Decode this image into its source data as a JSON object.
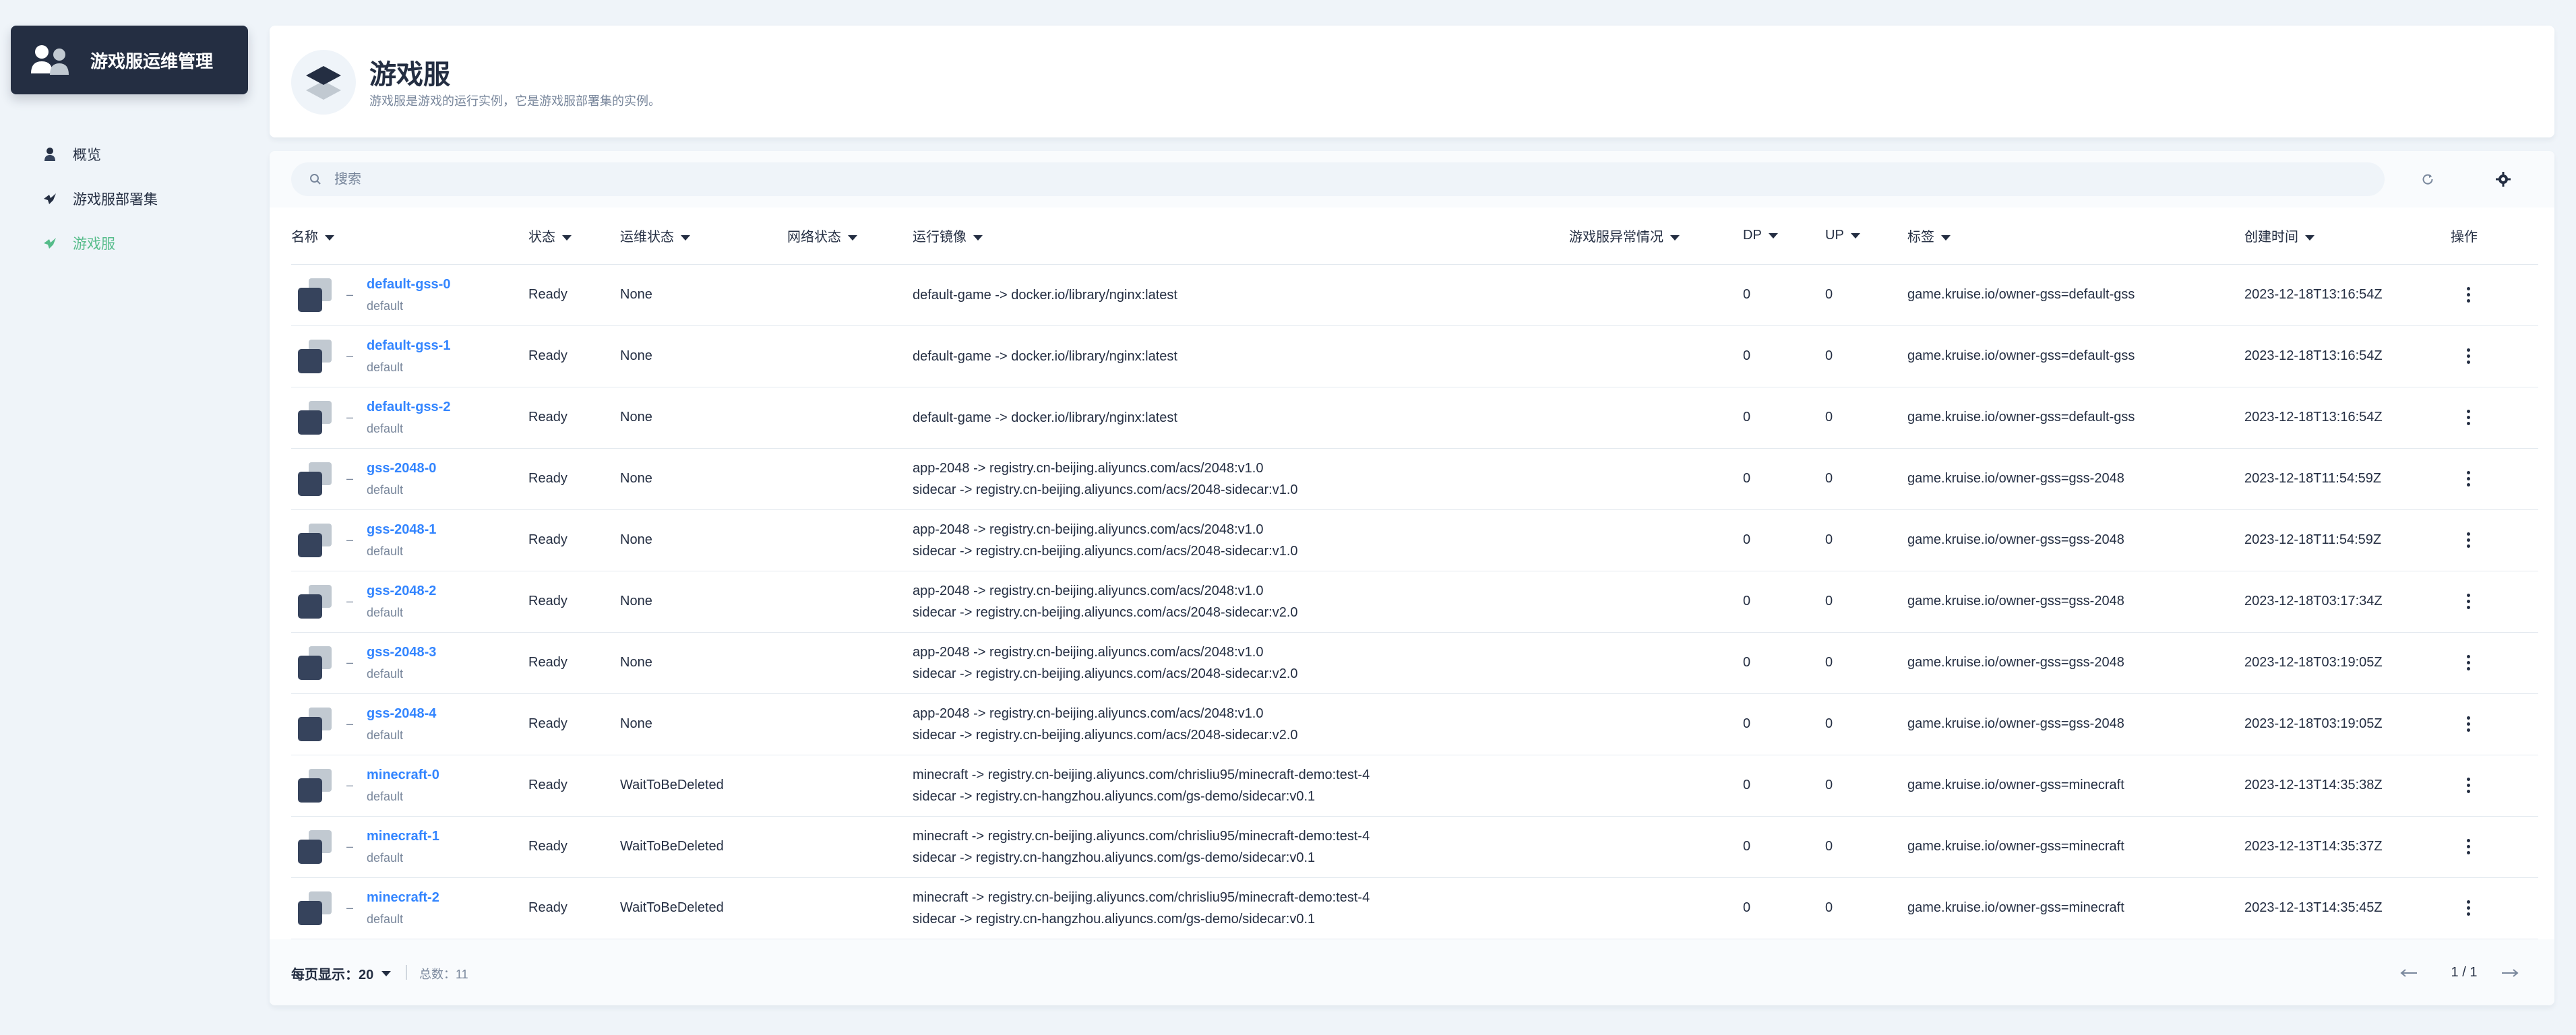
{
  "sidebar": {
    "brand": "游戏服运维管理",
    "items": [
      {
        "label": "概览",
        "icon": "user-icon",
        "active": false
      },
      {
        "label": "游戏服部署集",
        "icon": "bird-icon",
        "active": false
      },
      {
        "label": "游戏服",
        "icon": "bird-icon",
        "active": true
      }
    ]
  },
  "header": {
    "title": "游戏服",
    "description": "游戏服是游戏的运行实例，它是游戏服部署集的实例。"
  },
  "search": {
    "placeholder": "搜索"
  },
  "table": {
    "columns": [
      "名称",
      "状态",
      "运维状态",
      "网络状态",
      "运行镜像",
      "游戏服异常情况",
      "DP",
      "UP",
      "标签",
      "创建时间",
      "操作"
    ],
    "rows": [
      {
        "name": "default-gss-0",
        "namespace": "default",
        "dash": "–",
        "status": "Ready",
        "ops_state": "None",
        "image1": "default-game -> docker.io/library/nginx:latest",
        "image2": "",
        "dp": "0",
        "up": "0",
        "label": "game.kruise.io/owner-gss=default-gss",
        "created": "2023-12-18T13:16:54Z"
      },
      {
        "name": "default-gss-1",
        "namespace": "default",
        "dash": "–",
        "status": "Ready",
        "ops_state": "None",
        "image1": "default-game -> docker.io/library/nginx:latest",
        "image2": "",
        "dp": "0",
        "up": "0",
        "label": "game.kruise.io/owner-gss=default-gss",
        "created": "2023-12-18T13:16:54Z"
      },
      {
        "name": "default-gss-2",
        "namespace": "default",
        "dash": "–",
        "status": "Ready",
        "ops_state": "None",
        "image1": "default-game -> docker.io/library/nginx:latest",
        "image2": "",
        "dp": "0",
        "up": "0",
        "label": "game.kruise.io/owner-gss=default-gss",
        "created": "2023-12-18T13:16:54Z"
      },
      {
        "name": "gss-2048-0",
        "namespace": "default",
        "dash": "–",
        "status": "Ready",
        "ops_state": "None",
        "image1": "app-2048 -> registry.cn-beijing.aliyuncs.com/acs/2048:v1.0",
        "image2": "sidecar -> registry.cn-beijing.aliyuncs.com/acs/2048-sidecar:v1.0",
        "dp": "0",
        "up": "0",
        "label": "game.kruise.io/owner-gss=gss-2048",
        "created": "2023-12-18T11:54:59Z"
      },
      {
        "name": "gss-2048-1",
        "namespace": "default",
        "dash": "–",
        "status": "Ready",
        "ops_state": "None",
        "image1": "app-2048 -> registry.cn-beijing.aliyuncs.com/acs/2048:v1.0",
        "image2": "sidecar -> registry.cn-beijing.aliyuncs.com/acs/2048-sidecar:v1.0",
        "dp": "0",
        "up": "0",
        "label": "game.kruise.io/owner-gss=gss-2048",
        "created": "2023-12-18T11:54:59Z"
      },
      {
        "name": "gss-2048-2",
        "namespace": "default",
        "dash": "–",
        "status": "Ready",
        "ops_state": "None",
        "image1": "app-2048 -> registry.cn-beijing.aliyuncs.com/acs/2048:v1.0",
        "image2": "sidecar -> registry.cn-beijing.aliyuncs.com/acs/2048-sidecar:v2.0",
        "dp": "0",
        "up": "0",
        "label": "game.kruise.io/owner-gss=gss-2048",
        "created": "2023-12-18T03:17:34Z"
      },
      {
        "name": "gss-2048-3",
        "namespace": "default",
        "dash": "–",
        "status": "Ready",
        "ops_state": "None",
        "image1": "app-2048 -> registry.cn-beijing.aliyuncs.com/acs/2048:v1.0",
        "image2": "sidecar -> registry.cn-beijing.aliyuncs.com/acs/2048-sidecar:v2.0",
        "dp": "0",
        "up": "0",
        "label": "game.kruise.io/owner-gss=gss-2048",
        "created": "2023-12-18T03:19:05Z"
      },
      {
        "name": "gss-2048-4",
        "namespace": "default",
        "dash": "–",
        "status": "Ready",
        "ops_state": "None",
        "image1": "app-2048 -> registry.cn-beijing.aliyuncs.com/acs/2048:v1.0",
        "image2": "sidecar -> registry.cn-beijing.aliyuncs.com/acs/2048-sidecar:v2.0",
        "dp": "0",
        "up": "0",
        "label": "game.kruise.io/owner-gss=gss-2048",
        "created": "2023-12-18T03:19:05Z"
      },
      {
        "name": "minecraft-0",
        "namespace": "default",
        "dash": "–",
        "status": "Ready",
        "ops_state": "WaitToBeDeleted",
        "image1": "minecraft -> registry.cn-beijing.aliyuncs.com/chrisliu95/minecraft-demo:test-4",
        "image2": "sidecar -> registry.cn-hangzhou.aliyuncs.com/gs-demo/sidecar:v0.1",
        "dp": "0",
        "up": "0",
        "label": "game.kruise.io/owner-gss=minecraft",
        "created": "2023-12-13T14:35:38Z"
      },
      {
        "name": "minecraft-1",
        "namespace": "default",
        "dash": "–",
        "status": "Ready",
        "ops_state": "WaitToBeDeleted",
        "image1": "minecraft -> registry.cn-beijing.aliyuncs.com/chrisliu95/minecraft-demo:test-4",
        "image2": "sidecar -> registry.cn-hangzhou.aliyuncs.com/gs-demo/sidecar:v0.1",
        "dp": "0",
        "up": "0",
        "label": "game.kruise.io/owner-gss=minecraft",
        "created": "2023-12-13T14:35:37Z"
      },
      {
        "name": "minecraft-2",
        "namespace": "default",
        "dash": "–",
        "status": "Ready",
        "ops_state": "WaitToBeDeleted",
        "image1": "minecraft -> registry.cn-beijing.aliyuncs.com/chrisliu95/minecraft-demo:test-4",
        "image2": "sidecar -> registry.cn-hangzhou.aliyuncs.com/gs-demo/sidecar:v0.1",
        "dp": "0",
        "up": "0",
        "label": "game.kruise.io/owner-gss=minecraft",
        "created": "2023-12-13T14:35:45Z"
      }
    ]
  },
  "footer": {
    "per_page": "每页显示：20",
    "total": "总数：11",
    "page": "1 / 1"
  },
  "colors": {
    "brand_bg": "#242e42",
    "active_nav": "#55bc8a",
    "link": "#3385ff",
    "page_bg": "#eff4f9"
  }
}
